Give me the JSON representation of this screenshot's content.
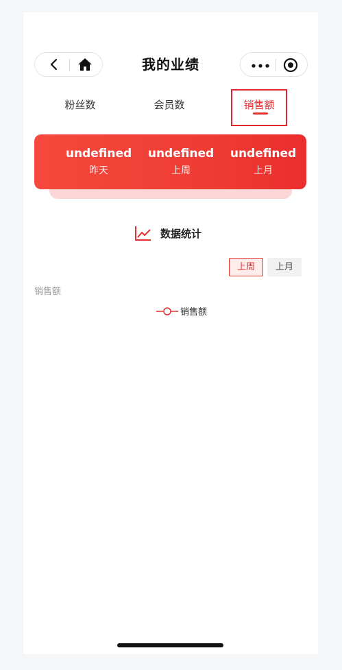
{
  "nav": {
    "title": "我的业绩"
  },
  "tabs": [
    {
      "label": "粉丝数"
    },
    {
      "label": "会员数"
    },
    {
      "label": "销售额",
      "active": true
    }
  ],
  "summary": {
    "stats": [
      {
        "value": "undefined",
        "label": "昨天"
      },
      {
        "value": "undefined",
        "label": "上周"
      },
      {
        "value": "undefined",
        "label": "上月"
      }
    ]
  },
  "section": {
    "title": "数据统计"
  },
  "range_toggle": {
    "options": [
      "上周",
      "上月"
    ],
    "selected": "上周"
  },
  "chart_data": {
    "type": "line",
    "ylabel": "销售额",
    "series": [
      {
        "name": "销售额",
        "values": []
      }
    ]
  },
  "colors": {
    "accent": "#e0302f",
    "card_start": "#f6483c",
    "card_end": "#ea2e2e"
  }
}
